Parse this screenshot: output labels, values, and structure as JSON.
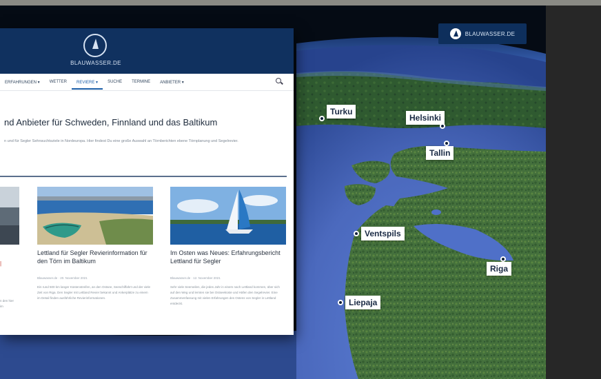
{
  "overlay_logo": {
    "text": "BLAUWASSER.DE",
    "icon": "sailboat-logo-icon"
  },
  "cities": [
    {
      "name": "Turku"
    },
    {
      "name": "Helsinki"
    },
    {
      "name": "Tallin"
    },
    {
      "name": "Ventspils"
    },
    {
      "name": "Riga"
    },
    {
      "name": "Liepaja"
    }
  ],
  "website": {
    "brand": "BLAUWASSER.DE",
    "nav": [
      {
        "label": "ERFAHRUNGEN ▾"
      },
      {
        "label": "WETTER"
      },
      {
        "label": "REVIERE ▾"
      },
      {
        "label": "SUCHE"
      },
      {
        "label": "TERMINE"
      },
      {
        "label": "ANBIETER ▾"
      }
    ],
    "active_nav": "REVIERE ▾",
    "headline": "nd Anbieter für Schweden, Finnland und das Baltikum",
    "intro": "n und für Segler Sehnsuchtsziele in Nordeuropa. Hier findest Du eine große Auswahl an Törnberichten ebene Törnplanung und Segelrevier.",
    "cards": [
      {
        "title": "Lettland für Segler Revierinformation für den Törn im Baltikum",
        "meta": "Blauwasser.de  ·  20. November 2021",
        "body": "Ein rund 500 km langer Küstenstreifen, an den Ostsee, Seeschiffahrt und der viele Zeit von Riga. Den Segler mit Lettland Revier bekannt und Ankerplätze zu einem im Detail finden ausführliche Revierinformationen."
      },
      {
        "title": "Im Osten was Neues: Erfahrungsbericht Lettland für Segler",
        "meta": "Blauwasser.de  ·  12. November 2021",
        "body": "Sehr viele Seemeilen, die jedes Jahr in einem nach Lettland kommen, über sich auf den Weg und lernten sie bei Ostseeküste und Häfen den Segelrevier. Eine Zusammenfassung mit vielen Erfahrungen des Ostens von Segler in Lettland entdeckt."
      }
    ],
    "fragment_text": "n den hier im"
  },
  "colors": {
    "header": "#10315f",
    "accent": "#1b5ea8",
    "sea": "#4f6fc6",
    "land": "#3f6a39"
  }
}
